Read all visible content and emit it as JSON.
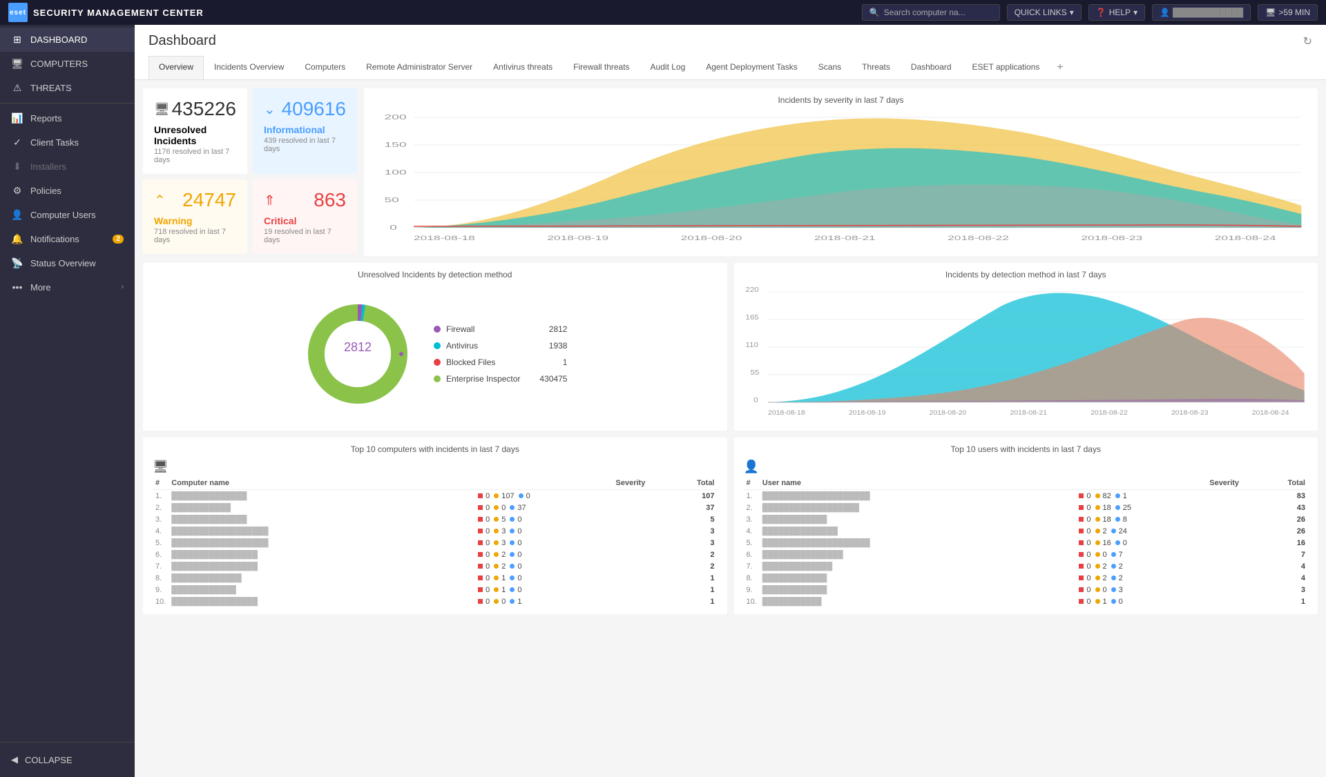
{
  "topbar": {
    "logo_text": "SECURITY MANAGEMENT CENTER",
    "search_placeholder": "Search computer na...",
    "quick_links": "QUICK LINKS",
    "help": "HELP",
    "session": ">59 MIN"
  },
  "sidebar": {
    "section_computers": "COMPUTERS",
    "items": [
      {
        "id": "dashboard",
        "label": "DASHBOARD",
        "icon": "⊞",
        "active": true
      },
      {
        "id": "computers",
        "label": "COMPUTERS",
        "icon": "🖥",
        "active": false
      },
      {
        "id": "threats",
        "label": "THREATS",
        "icon": "⚠",
        "active": false
      },
      {
        "id": "reports",
        "label": "Reports",
        "icon": "📊",
        "active": false
      },
      {
        "id": "client-tasks",
        "label": "Client Tasks",
        "icon": "✓",
        "active": false
      },
      {
        "id": "installers",
        "label": "Installers",
        "icon": "⬇",
        "active": false,
        "disabled": true
      },
      {
        "id": "policies",
        "label": "Policies",
        "icon": "⚙",
        "active": false
      },
      {
        "id": "computer-users",
        "label": "Computer Users",
        "icon": "👤",
        "active": false
      },
      {
        "id": "notifications",
        "label": "Notifications",
        "icon": "🔔",
        "active": false,
        "badge": "2"
      },
      {
        "id": "status-overview",
        "label": "Status Overview",
        "icon": "📡",
        "active": false
      },
      {
        "id": "more",
        "label": "More",
        "icon": "•••",
        "active": false,
        "arrow": true
      }
    ],
    "collapse": "COLLAPSE"
  },
  "dashboard": {
    "title": "Dashboard",
    "tabs": [
      {
        "id": "overview",
        "label": "Overview",
        "active": true
      },
      {
        "id": "incidents-overview",
        "label": "Incidents Overview"
      },
      {
        "id": "computers",
        "label": "Computers"
      },
      {
        "id": "remote-admin",
        "label": "Remote Administrator Server"
      },
      {
        "id": "antivirus",
        "label": "Antivirus threats"
      },
      {
        "id": "firewall",
        "label": "Firewall threats"
      },
      {
        "id": "audit-log",
        "label": "Audit Log"
      },
      {
        "id": "agent-deployment",
        "label": "Agent Deployment Tasks"
      },
      {
        "id": "scans",
        "label": "Scans"
      },
      {
        "id": "threats",
        "label": "Threats"
      },
      {
        "id": "dashboard2",
        "label": "Dashboard"
      },
      {
        "id": "eset-apps",
        "label": "ESET applications"
      }
    ],
    "stats": {
      "unresolved": {
        "number": "435226",
        "label": "Unresolved Incidents",
        "sublabel": "1176 resolved in last 7 days"
      },
      "informational": {
        "number": "409616",
        "label": "Informational",
        "sublabel": "439 resolved in last 7 days",
        "color": "blue"
      },
      "warning": {
        "number": "24747",
        "label": "Warning",
        "sublabel": "718 resolved in last 7 days",
        "color": "orange"
      },
      "critical": {
        "number": "863",
        "label": "Critical",
        "sublabel": "19 resolved in last 7 days",
        "color": "red"
      }
    },
    "chart1_title": "Incidents by severity in last 7 days",
    "chart2_title": "Unresolved Incidents by detection method",
    "chart3_title": "Incidents by detection method in last 7 days",
    "donut": {
      "center_value": "2812",
      "legend": [
        {
          "label": "Firewall",
          "color": "#9b59b6",
          "count": "2812"
        },
        {
          "label": "Antivirus",
          "color": "#00bcd4",
          "count": "1938"
        },
        {
          "label": "Blocked Files",
          "color": "#e84040",
          "count": "1"
        },
        {
          "label": "Enterprise Inspector",
          "color": "#8bc34a",
          "count": "430475"
        }
      ]
    },
    "top_computers_title": "Top 10 computers with incidents in last 7 days",
    "top_users_title": "Top 10 users with incidents in last 7 days",
    "computers_columns": [
      "Computer name",
      "Severity",
      "Total"
    ],
    "users_columns": [
      "User name",
      "Severity",
      "Total"
    ],
    "computers_rows": [
      {
        "num": "1.",
        "name": "██████████████",
        "sev_r": "0",
        "sev_o": "107",
        "sev_b": "0",
        "total": "107"
      },
      {
        "num": "2.",
        "name": "███████████",
        "sev_r": "0",
        "sev_o": "0",
        "sev_b": "37",
        "total": "37"
      },
      {
        "num": "3.",
        "name": "██████████████",
        "sev_r": "0",
        "sev_o": "5",
        "sev_b": "0",
        "total": "5"
      },
      {
        "num": "4.",
        "name": "██████████████████",
        "sev_r": "0",
        "sev_o": "3",
        "sev_b": "0",
        "total": "3"
      },
      {
        "num": "5.",
        "name": "██████████████████",
        "sev_r": "0",
        "sev_o": "3",
        "sev_b": "0",
        "total": "3"
      },
      {
        "num": "6.",
        "name": "████████████████",
        "sev_r": "0",
        "sev_o": "2",
        "sev_b": "0",
        "total": "2"
      },
      {
        "num": "7.",
        "name": "████████████████",
        "sev_r": "0",
        "sev_o": "2",
        "sev_b": "0",
        "total": "2"
      },
      {
        "num": "8.",
        "name": "█████████████",
        "sev_r": "0",
        "sev_o": "1",
        "sev_b": "0",
        "total": "1"
      },
      {
        "num": "9.",
        "name": "████████████",
        "sev_r": "0",
        "sev_o": "1",
        "sev_b": "0",
        "total": "1"
      },
      {
        "num": "10.",
        "name": "████████████████",
        "sev_r": "0",
        "sev_o": "0",
        "sev_b": "1",
        "total": "1"
      }
    ],
    "users_rows": [
      {
        "num": "1.",
        "name": "████████████████████",
        "sev_r": "0",
        "sev_o": "82",
        "sev_b": "1",
        "total": "83"
      },
      {
        "num": "2.",
        "name": "██████████████████",
        "sev_r": "0",
        "sev_o": "18",
        "sev_b": "25",
        "total": "43"
      },
      {
        "num": "3.",
        "name": "████████████",
        "sev_r": "0",
        "sev_o": "18",
        "sev_b": "8",
        "total": "26"
      },
      {
        "num": "4.",
        "name": "██████████████",
        "sev_r": "0",
        "sev_o": "2",
        "sev_b": "24",
        "total": "26"
      },
      {
        "num": "5.",
        "name": "████████████████████",
        "sev_r": "0",
        "sev_o": "16",
        "sev_b": "0",
        "total": "16"
      },
      {
        "num": "6.",
        "name": "███████████████",
        "sev_r": "0",
        "sev_o": "0",
        "sev_b": "7",
        "total": "7"
      },
      {
        "num": "7.",
        "name": "█████████████",
        "sev_r": "0",
        "sev_o": "2",
        "sev_b": "2",
        "total": "4"
      },
      {
        "num": "8.",
        "name": "████████████",
        "sev_r": "0",
        "sev_o": "2",
        "sev_b": "2",
        "total": "4"
      },
      {
        "num": "9.",
        "name": "████████████",
        "sev_r": "0",
        "sev_o": "0",
        "sev_b": "3",
        "total": "3"
      },
      {
        "num": "10.",
        "name": "███████████",
        "sev_r": "0",
        "sev_o": "1",
        "sev_b": "0",
        "total": "1"
      }
    ],
    "chart_dates": [
      "2018-08-18",
      "2018-08-19",
      "2018-08-20",
      "2018-08-21",
      "2018-08-22",
      "2018-08-23",
      "2018-08-24"
    ]
  }
}
